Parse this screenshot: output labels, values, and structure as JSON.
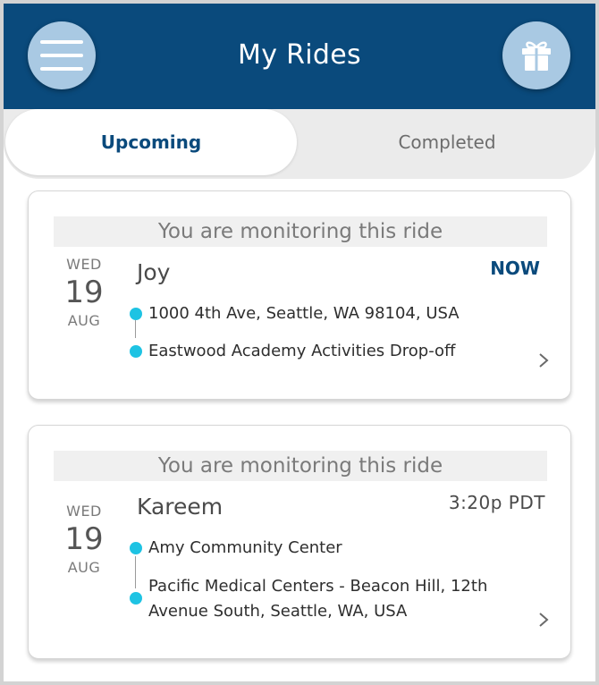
{
  "header": {
    "title": "My Rides",
    "menu_icon": "hamburger-menu-icon",
    "gift_icon": "gift-icon",
    "bg_color": "#0a4a7c"
  },
  "tabs": [
    {
      "label": "Upcoming",
      "active": true
    },
    {
      "label": "Completed",
      "active": false
    }
  ],
  "rides": [
    {
      "monitoring": "You are monitoring this ride",
      "day_of_week": "WED",
      "day": "19",
      "month": "AUG",
      "driver": "Joy",
      "time": "NOW",
      "pickup": "1000 4th Ave, Seattle, WA 98104, USA",
      "dropoff": "Eastwood Academy Activities Drop-off"
    },
    {
      "monitoring": "You are monitoring this ride",
      "day_of_week": "WED",
      "day": "19",
      "month": "AUG",
      "driver": "Kareem",
      "time": "3:20p PDT",
      "pickup": "Amy Community Center",
      "dropoff": "Pacific Medical Centers - Beacon Hill, 12th Avenue South, Seattle, WA, USA"
    }
  ],
  "colors": {
    "accent": "#0a4a7c",
    "stop_dot": "#1ec3e3",
    "button_circle": "#a9c9e3"
  }
}
